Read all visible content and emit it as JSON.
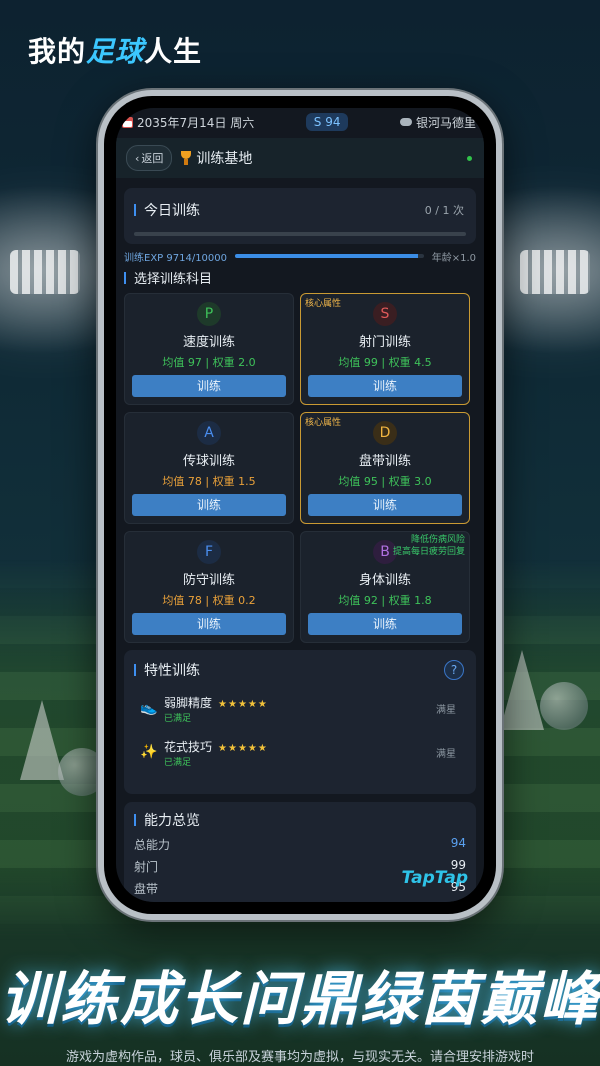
{
  "promo": {
    "title_prefix": "我的",
    "title_accent": "足球",
    "title_suffix": "人生",
    "slogan": "训练成长问鼎绿茵巅峰",
    "disclaimer": "游戏为虚构作品，球员、俱乐部及赛事均为虚拟，与现实无关。请合理安排游戏时",
    "watermark": "TapTap"
  },
  "status": {
    "date": "2035年7月14日 周六",
    "season_badge": "S 94",
    "club": "银河马德里"
  },
  "header": {
    "back_label": "返回",
    "title": "训练基地"
  },
  "today": {
    "title": "今日训练",
    "count": "0 / 1 次",
    "progress": 0
  },
  "exp": {
    "label": "训练EXP 9714/10000",
    "current": 9714,
    "max": 10000,
    "age_multiplier": "年龄×1.0"
  },
  "select_title": "选择训练科目",
  "trainings": [
    {
      "letter": "P",
      "name": "速度训练",
      "stat": "均值 97 | 权重 2.0",
      "stat_color": "green",
      "letter_color": "#3ec25a",
      "letter_bg": "#1e3a2a",
      "core": false,
      "core_tag": "",
      "tip": [],
      "button": "训练"
    },
    {
      "letter": "S",
      "name": "射门训练",
      "stat": "均值 99 | 权重 4.5",
      "stat_color": "green",
      "letter_color": "#e05a5a",
      "letter_bg": "#3a1e22",
      "core": true,
      "core_tag": "核心属性",
      "tip": [],
      "button": "训练"
    },
    {
      "letter": "A",
      "name": "传球训练",
      "stat": "均值 78 | 权重 1.5",
      "stat_color": "orange",
      "letter_color": "#4a8ef0",
      "letter_bg": "#1c2c44",
      "core": false,
      "core_tag": "",
      "tip": [],
      "button": "训练"
    },
    {
      "letter": "D",
      "name": "盘带训练",
      "stat": "均值 95 | 权重 3.0",
      "stat_color": "green",
      "letter_color": "#f0b440",
      "letter_bg": "#3a2e18",
      "core": true,
      "core_tag": "核心属性",
      "tip": [],
      "button": "训练"
    },
    {
      "letter": "F",
      "name": "防守训练",
      "stat": "均值 78 | 权重 0.2",
      "stat_color": "orange",
      "letter_color": "#4a8ef0",
      "letter_bg": "#1c2c44",
      "core": false,
      "core_tag": "",
      "tip": [],
      "button": "训练"
    },
    {
      "letter": "B",
      "name": "身体训练",
      "stat": "均值 92 | 权重 1.8",
      "stat_color": "green",
      "letter_color": "#b070e0",
      "letter_bg": "#2e1e3e",
      "core": false,
      "core_tag": "",
      "tip": [
        "降低伤病风险",
        "提高每日疲劳回复"
      ],
      "button": "训练"
    }
  ],
  "special": {
    "title": "特性训练",
    "help": "?",
    "items": [
      {
        "icon": "boot-icon",
        "glyph": "👟",
        "name": "弱脚精度",
        "stars": "★★★★★",
        "sub": "已满足",
        "state": "满星"
      },
      {
        "icon": "sparkle-icon",
        "glyph": "✨",
        "name": "花式技巧",
        "stars": "★★★★★",
        "sub": "已满足",
        "state": "满星"
      }
    ]
  },
  "overview": {
    "title": "能力总览",
    "rows": [
      {
        "label": "总能力",
        "value": "94"
      },
      {
        "label": "射门",
        "value": "99"
      },
      {
        "label": "盘带",
        "value": "95"
      }
    ]
  }
}
